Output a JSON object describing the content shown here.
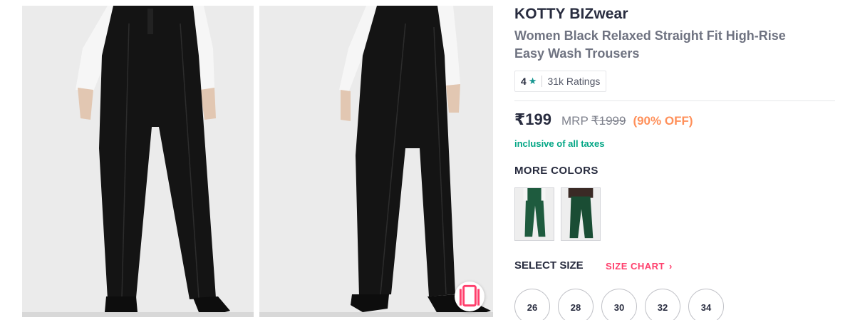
{
  "product": {
    "brand": "KOTTY BIZwear",
    "name": "Women Black Relaxed Straight Fit High-Rise Easy Wash Trousers",
    "rating": {
      "value": "4",
      "star_icon": "star-icon",
      "count": "31k Ratings"
    },
    "price": {
      "current": "₹199",
      "mrp_label": "MRP",
      "mrp_value": "₹1999",
      "discount": "(90% OFF)",
      "tax_note": "inclusive of all taxes"
    },
    "more_colors": {
      "title": "MORE COLORS",
      "swatches": [
        "green-trousers-swatch",
        "green-trousers-swatch"
      ]
    },
    "size": {
      "title": "SELECT SIZE",
      "chart_label": "SIZE CHART",
      "options": [
        "26",
        "28",
        "30",
        "32",
        "34"
      ]
    }
  },
  "images": {
    "icons": [
      "similar-products-icon"
    ]
  },
  "colors": {
    "rating_star": "#14958f",
    "discount": "#ff905a",
    "tax_note": "#03a685",
    "size_chart": "#ff3f6c",
    "swatch_green": "#1e5b3e",
    "trousers": "#141414"
  }
}
